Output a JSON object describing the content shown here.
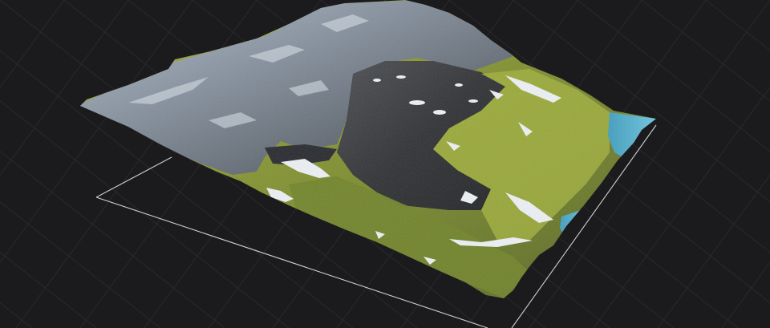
{
  "viewport": {
    "background": "#1b1b1d",
    "grid_color": "#2a2a2d",
    "bounds_color": "#cfcfcf"
  },
  "terrain": {
    "snow_color": "#eef2f6",
    "rock_color": "#6f7a86",
    "dark_rock_color": "#2b2c2e",
    "grass_color": "#8a9a2a",
    "water_color": "#5fb3cf"
  }
}
